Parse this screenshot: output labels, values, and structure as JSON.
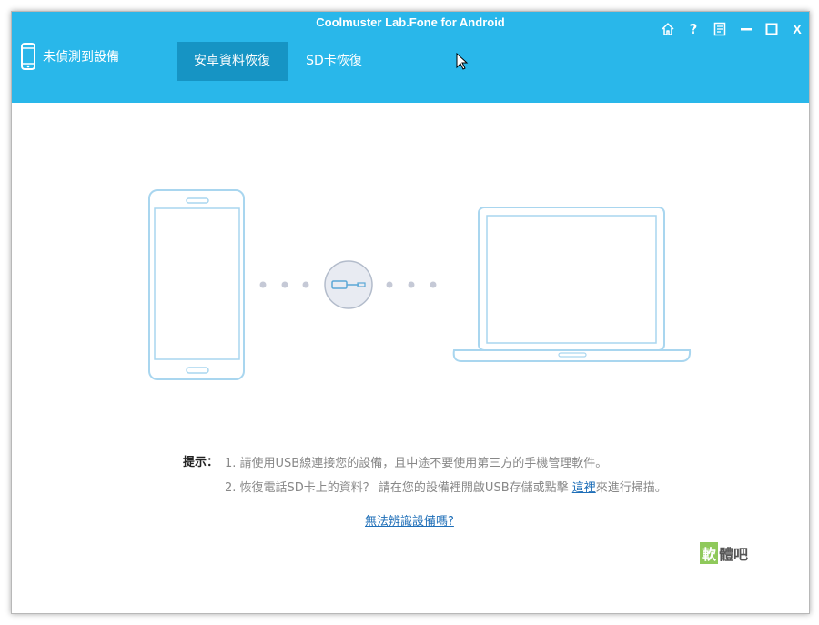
{
  "window": {
    "title": "Coolmuster Lab.Fone for Android"
  },
  "device_status": "未偵測到設備",
  "tabs": [
    {
      "label": "安卓資料恢復",
      "active": true
    },
    {
      "label": "SD卡恢復",
      "active": false
    }
  ],
  "controls": {
    "home": "home-icon",
    "help": "?",
    "feedback": "feedback-icon",
    "minimize": "minimize-icon",
    "maximize": "maximize-icon",
    "close": "X"
  },
  "tips": {
    "label": "提示：",
    "line1": "1. 請使用USB線連接您的設備，且中途不要使用第三方的手機管理軟件。",
    "line2_prefix": "2. 恢復電話SD卡上的資料？ 請在您的設備裡開啟USB存儲或點擊 ",
    "line2_link": "這裡",
    "line2_suffix": "來進行掃描。"
  },
  "help_link": "無法辨識設備嗎?",
  "watermark": {
    "part1": "軟",
    "part2": "體吧"
  },
  "colors": {
    "header": "#29b7ea",
    "active_tab": "#1694c4",
    "illustration": "#a9d6ef",
    "link": "#1f6fb8"
  }
}
